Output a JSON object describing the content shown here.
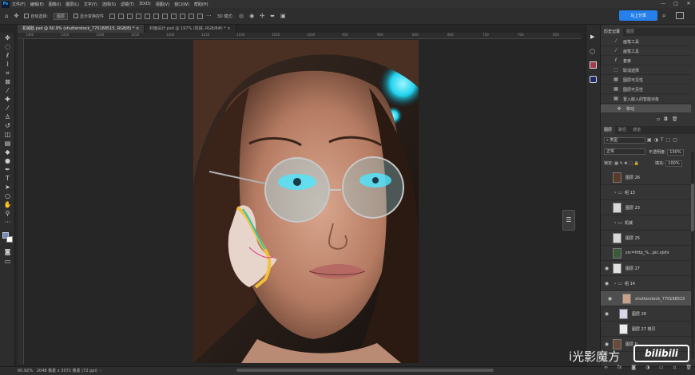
{
  "app": {
    "logo": "Ps"
  },
  "menu": [
    "文件(F)",
    "编辑(E)",
    "图像(I)",
    "图层(L)",
    "文字(Y)",
    "选择(S)",
    "滤镜(T)",
    "3D(D)",
    "视图(V)",
    "窗口(W)",
    "帮助(H)"
  ],
  "window_controls": [
    "—",
    "□",
    "✕"
  ],
  "options": {
    "auto_select_label": "自动选择:",
    "auto_select_target": "图层",
    "show_transform_label": "显示变换控件",
    "mode_3d_label": "3D 模式:",
    "share_label": "马上分享"
  },
  "tabs": [
    {
      "label": "机械脸.psd @ 60.9% (shutterstock_770168515, RGB/8) *",
      "active": true
    },
    {
      "label": "封面设计.psd @ 197% (机械, RGB/8#) *",
      "active": false
    }
  ],
  "ruler_ticks": [
    "1400",
    "1350",
    "1300",
    "1250",
    "1200",
    "1150",
    "1100",
    "1050",
    "1000",
    "950",
    "900",
    "850",
    "800",
    "750",
    "700",
    "650"
  ],
  "status": {
    "zoom": "60.92%",
    "doc_info": "2048 像素 x 3072 像素 (72 ppi)"
  },
  "history": {
    "tabs": [
      "历史记录",
      "图层"
    ],
    "items": [
      {
        "icon": "brush-icon",
        "label": "画笔工具",
        "selected": false
      },
      {
        "icon": "brush-icon",
        "label": "画笔工具",
        "selected": false
      },
      {
        "icon": "lasso-icon",
        "label": "套索",
        "selected": false
      },
      {
        "icon": "deselect-icon",
        "label": "取消选择",
        "selected": false
      },
      {
        "icon": "visibility-icon",
        "label": "图层可见性",
        "selected": false
      },
      {
        "icon": "visibility-icon",
        "label": "图层可见性",
        "selected": false
      },
      {
        "icon": "place-icon",
        "label": "置入嵌入的智能对象",
        "selected": false
      },
      {
        "icon": "move-icon",
        "label": "移动",
        "selected": true
      }
    ]
  },
  "layers": {
    "tabs": [
      "图层",
      "路径",
      "通道"
    ],
    "filter": "类型",
    "blend_mode": "正常",
    "opacity_label": "不透明度:",
    "opacity": "100%",
    "lock_label": "锁定:",
    "fill_label": "填充:",
    "fill": "100%",
    "items": [
      {
        "name": "图层 26",
        "visible": false,
        "thumb": "#5a3a2a",
        "selected": false,
        "folder": false,
        "indent": 0
      },
      {
        "name": "组 13",
        "visible": false,
        "thumb": "",
        "selected": false,
        "folder": true,
        "indent": 0
      },
      {
        "name": "图层 23",
        "visible": false,
        "thumb": "#d8d8d8",
        "selected": false,
        "folder": false,
        "indent": 0
      },
      {
        "name": "机械",
        "visible": false,
        "thumb": "",
        "selected": false,
        "folder": true,
        "indent": 0
      },
      {
        "name": "图层 25",
        "visible": false,
        "thumb": "#d8d8d8",
        "selected": false,
        "folder": false,
        "indent": 0
      },
      {
        "name": "src=http_%...pic.vjshi",
        "visible": false,
        "thumb": "#3a5a3a",
        "selected": false,
        "folder": false,
        "indent": 0
      },
      {
        "name": "图层 27",
        "visible": true,
        "thumb": "#e0e0e0",
        "selected": false,
        "folder": false,
        "indent": 0
      },
      {
        "name": "组 14",
        "visible": true,
        "thumb": "#222",
        "selected": false,
        "folder": true,
        "indent": 0
      },
      {
        "name": "shutterstock_770168515",
        "visible": true,
        "thumb": "#c9a088",
        "selected": true,
        "folder": false,
        "indent": 1
      },
      {
        "name": "图层 28",
        "visible": true,
        "thumb": "#d8d8e8",
        "selected": false,
        "folder": false,
        "indent": 1
      },
      {
        "name": "图层 27 拷贝",
        "visible": false,
        "thumb": "#ececec",
        "selected": false,
        "folder": false,
        "indent": 1
      },
      {
        "name": "图层 0",
        "visible": true,
        "thumb": "#6a4a3a",
        "selected": false,
        "folder": false,
        "indent": 0
      }
    ]
  },
  "watermark": {
    "text": "i光影魔方",
    "logo": "bilibili"
  }
}
